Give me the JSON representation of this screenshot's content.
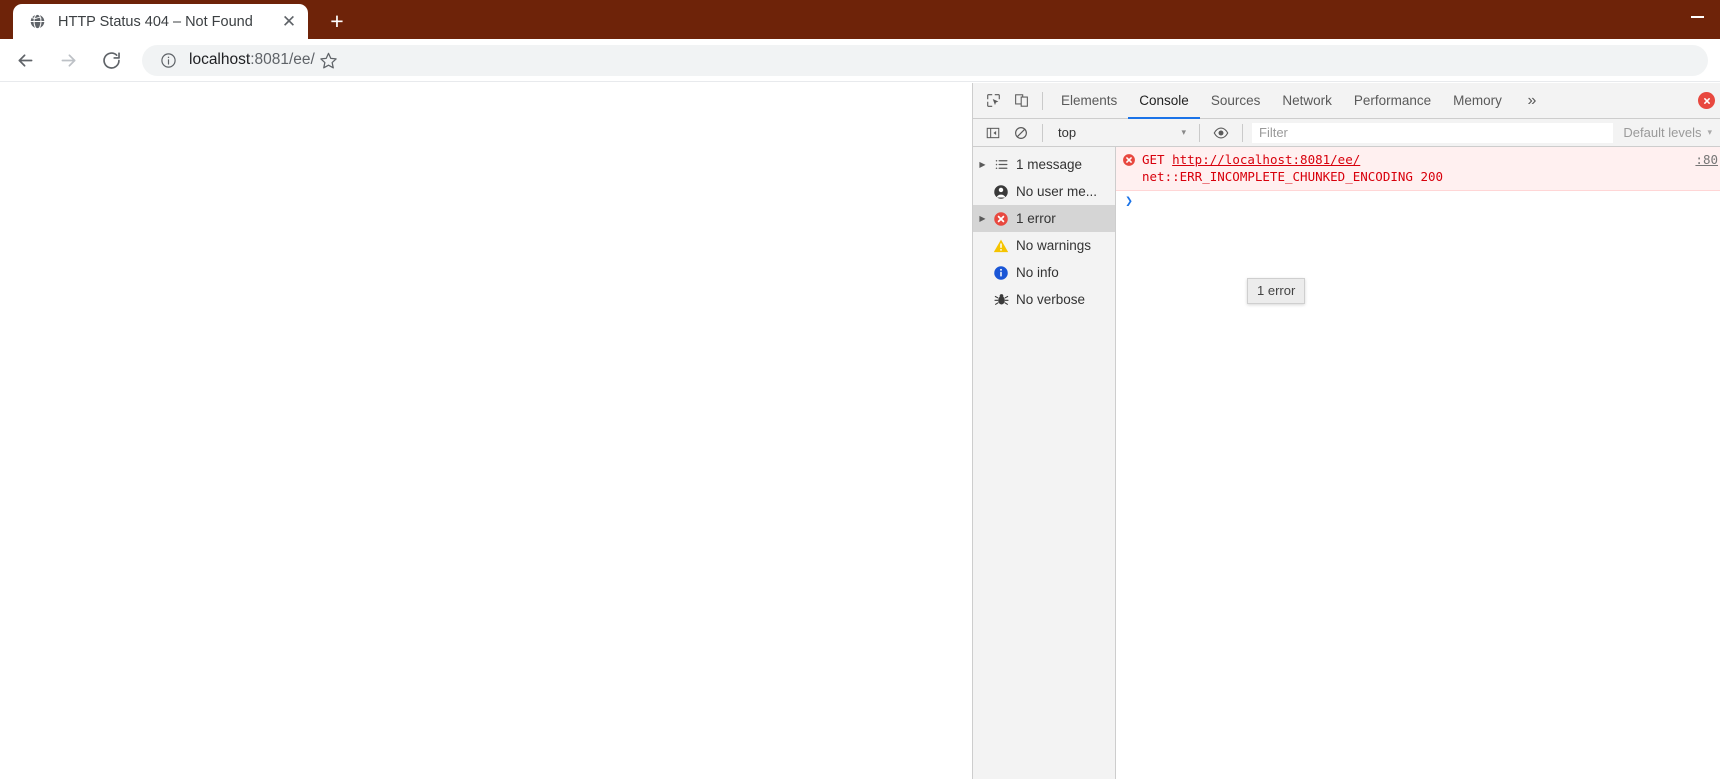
{
  "browser": {
    "tab": {
      "title": "HTTP Status 404 – Not Found",
      "favicon_name": "globe-icon",
      "close_label": "✕"
    },
    "new_tab_label": "+",
    "window_controls": {
      "minimize_label": "—"
    },
    "toolbar": {
      "back_label": "←",
      "forward_label": "→",
      "reload_label": "↻",
      "info_label": "ⓘ",
      "url_host": "localhost",
      "url_rest": ":8081/ee/",
      "url_full": "localhost:8081/ee/",
      "bookmark_label": "☆"
    },
    "accent_color": "#6e2309"
  },
  "devtools": {
    "tabbar": {
      "inspect_icon": "inspect-element-icon",
      "device_icon": "device-toolbar-icon",
      "tabs": [
        {
          "label": "Elements",
          "active": false
        },
        {
          "label": "Console",
          "active": true
        },
        {
          "label": "Sources",
          "active": false
        },
        {
          "label": "Network",
          "active": false
        },
        {
          "label": "Performance",
          "active": false
        },
        {
          "label": "Memory",
          "active": false
        }
      ],
      "more_label": "»",
      "error_badge": {
        "count": "",
        "color": "#e8483f"
      }
    },
    "console_toolbar": {
      "sidebar_toggle_icon": "console-sidebar-toggle-icon",
      "clear_icon": "clear-console-icon",
      "context_value": "top",
      "context_arrow": "▾",
      "eye_icon": "live-expression-eye-icon",
      "filter_placeholder": "Filter",
      "filter_value": "",
      "levels_label": "Default levels",
      "levels_arrow": "▾"
    },
    "sidebar": {
      "items": [
        {
          "label": "1 message",
          "icon": "list-icon",
          "arrow": "▶",
          "selected": false,
          "color": "#5a5a5a"
        },
        {
          "label": "No user me...",
          "icon": "user-icon",
          "arrow": "",
          "selected": false,
          "color": "#444444"
        },
        {
          "label": "1 error",
          "icon": "error-icon",
          "arrow": "▶",
          "selected": true,
          "color": "#e8483f"
        },
        {
          "label": "No warnings",
          "icon": "warning-icon",
          "arrow": "",
          "selected": false,
          "color": "#f5c400"
        },
        {
          "label": "No info",
          "icon": "info-icon",
          "arrow": "",
          "selected": false,
          "color": "#1a56d6"
        },
        {
          "label": "No verbose",
          "icon": "bug-icon",
          "arrow": "",
          "selected": false,
          "color": "#444444"
        }
      ]
    },
    "console": {
      "message": {
        "icon": "error-icon",
        "method": "GET ",
        "url": "http://localhost:8081/ee/",
        "detail": "net::ERR_INCOMPLETE_CHUNKED_ENCODING 200",
        "source": ":80",
        "color": "#d8000c"
      },
      "prompt_caret": "❯",
      "prompt_value": ""
    },
    "tooltip": {
      "text": "1 error"
    }
  }
}
